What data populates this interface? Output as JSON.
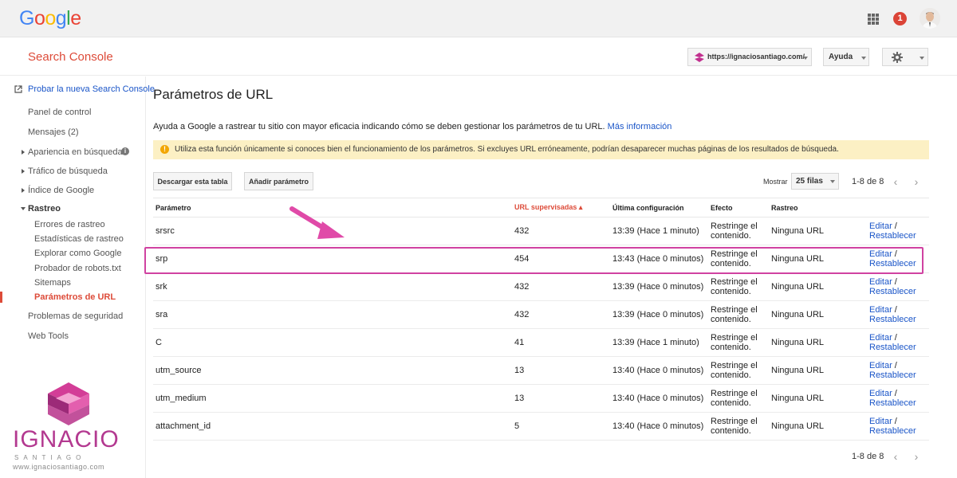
{
  "google": {
    "logo_letters": [
      "G",
      "o",
      "o",
      "g",
      "l",
      "e"
    ],
    "logo_colors": [
      "#4285F4",
      "#EA4335",
      "#FBBC05",
      "#4285F4",
      "#34A853",
      "#EA4335"
    ],
    "notification_count": "1"
  },
  "header": {
    "app_title": "Search Console",
    "site_selector": "https://ignaciosantiago.com/",
    "help_label": "Ayuda"
  },
  "sidebar": {
    "try_new": "Probar la nueva Search Console",
    "items": [
      {
        "label": "Panel de control"
      },
      {
        "label": "Mensajes (2)"
      },
      {
        "label": "Apariencia en búsquedas"
      },
      {
        "label": "Tráfico de búsqueda"
      },
      {
        "label": "Índice de Google"
      },
      {
        "label": "Rastreo"
      }
    ],
    "crawl_sub": [
      {
        "label": "Errores de rastreo"
      },
      {
        "label": "Estadísticas de rastreo"
      },
      {
        "label": "Explorar como Google"
      },
      {
        "label": "Probador de robots.txt"
      },
      {
        "label": "Sitemaps"
      },
      {
        "label": "Parámetros de URL"
      }
    ],
    "security": "Problemas de seguridad",
    "web_tools": "Web Tools"
  },
  "branding": {
    "word": "IGNACIO",
    "sub": "SANTIAGO",
    "url": "www.ignaciosantiago.com"
  },
  "main": {
    "title": "Parámetros de URL",
    "intro": "Ayuda a Google a rastrear tu sitio con mayor eficacia indicando cómo se deben gestionar los parámetros de tu URL.",
    "more_info": "Más información",
    "warning": "Utiliza esta función únicamente si conoces bien el funcionamiento de los parámetros. Si excluyes URL erróneamente, podrían desaparecer muchas páginas de los resultados de búsqueda.",
    "download_btn": "Descargar esta tabla",
    "add_btn": "Añadir parámetro",
    "show_label": "Mostrar",
    "rows_value": "25 filas",
    "pager": "1-8 de 8",
    "columns": [
      "Parámetro",
      "URL supervisadas",
      "Última configuración",
      "Efecto",
      "Rastreo"
    ],
    "rows": [
      {
        "param": "srsrc",
        "urls": "432",
        "config": "13:39 (Hace 1 minuto)",
        "effect_1": "Restringe el",
        "effect_2": "contenido.",
        "crawl": "Ninguna URL",
        "edit": "Editar",
        "reset": "Restablecer"
      },
      {
        "param": "srp",
        "urls": "454",
        "config": "13:43 (Hace 0 minutos)",
        "effect_1": "Restringe el",
        "effect_2": "contenido.",
        "crawl": "Ninguna URL",
        "edit": "Editar",
        "reset": "Restablecer"
      },
      {
        "param": "srk",
        "urls": "432",
        "config": "13:39 (Hace 0 minutos)",
        "effect_1": "Restringe el",
        "effect_2": "contenido.",
        "crawl": "Ninguna URL",
        "edit": "Editar",
        "reset": "Restablecer"
      },
      {
        "param": "sra",
        "urls": "432",
        "config": "13:39 (Hace 0 minutos)",
        "effect_1": "Restringe el",
        "effect_2": "contenido.",
        "crawl": "Ninguna URL",
        "edit": "Editar",
        "reset": "Restablecer"
      },
      {
        "param": "C",
        "urls": "41",
        "config": "13:39 (Hace 1 minuto)",
        "effect_1": "Restringe el",
        "effect_2": "contenido.",
        "crawl": "Ninguna URL",
        "edit": "Editar",
        "reset": "Restablecer"
      },
      {
        "param": "utm_source",
        "urls": "13",
        "config": "13:40 (Hace 0 minutos)",
        "effect_1": "Restringe el",
        "effect_2": "contenido.",
        "crawl": "Ninguna URL",
        "edit": "Editar",
        "reset": "Restablecer"
      },
      {
        "param": "utm_medium",
        "urls": "13",
        "config": "13:40 (Hace 0 minutos)",
        "effect_1": "Restringe el",
        "effect_2": "contenido.",
        "crawl": "Ninguna URL",
        "edit": "Editar",
        "reset": "Restablecer"
      },
      {
        "param": "attachment_id",
        "urls": "5",
        "config": "13:40 (Hace 0 minutos)",
        "effect_1": "Restringe el",
        "effect_2": "contenido.",
        "crawl": "Ninguna URL",
        "edit": "Editar",
        "reset": "Restablecer"
      }
    ]
  },
  "colors": {
    "accent_red": "#dd4b39",
    "link_blue": "#1a55c8",
    "highlight_pink": "#d042a1",
    "warning_bg": "#fcf0c4"
  },
  "icons": {
    "apps": "apps-grid-icon",
    "settings": "gear-icon",
    "external": "external-link-icon",
    "info": "info-icon",
    "warning": "warning-icon"
  }
}
